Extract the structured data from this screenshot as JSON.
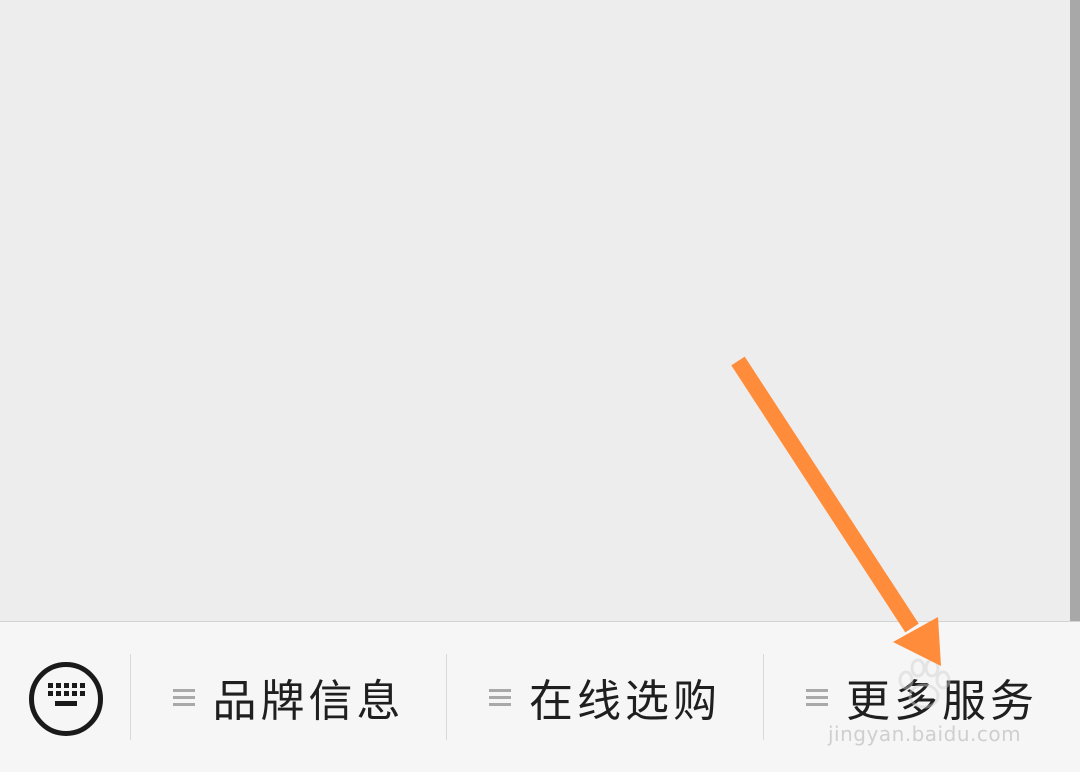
{
  "chat": {
    "scrollbar": "visible"
  },
  "menu_bar": {
    "keyboard_toggle": {
      "icon": "keyboard-icon"
    },
    "items": [
      {
        "label": "品牌信息",
        "icon": "menu-lines-icon"
      },
      {
        "label": "在线选购",
        "icon": "menu-lines-icon"
      },
      {
        "label": "更多服务",
        "icon": "menu-lines-icon"
      }
    ]
  },
  "annotation": {
    "arrow_color": "#ff8c3a",
    "points_to": "更多服务"
  },
  "watermark": {
    "text": "jingyan.baidu.com"
  },
  "colors": {
    "background": "#ededed",
    "menu_bar": "#f6f6f6",
    "label": "#1f1f1f",
    "arrow": "#ff8c3a"
  }
}
